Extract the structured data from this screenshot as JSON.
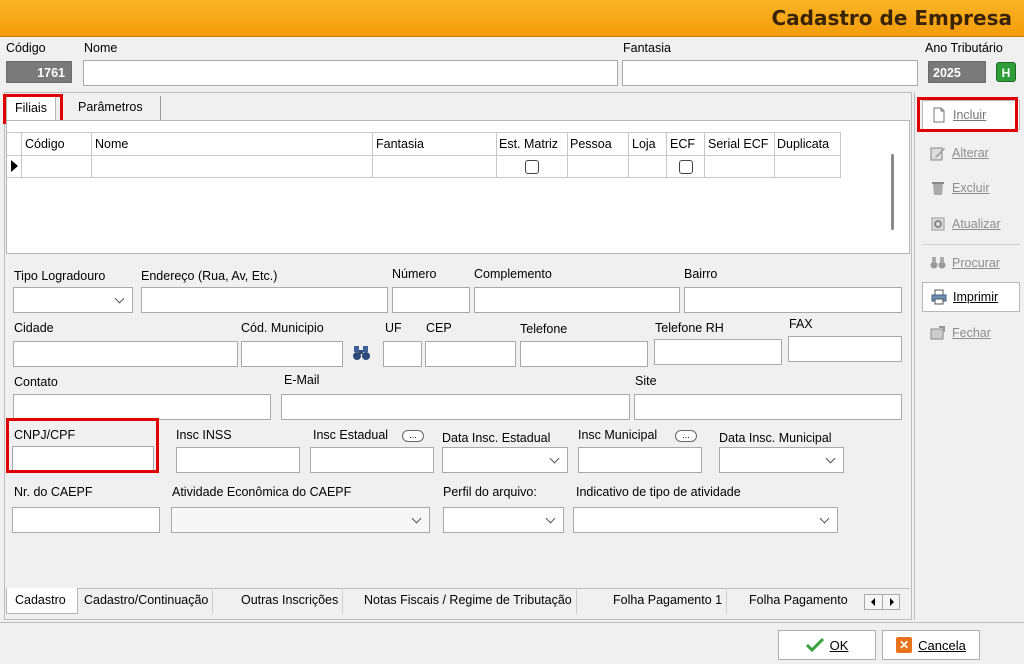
{
  "window": {
    "title": "Cadastro de Empresa"
  },
  "header": {
    "codigo_label": "Código",
    "codigo_value": "1761",
    "nome_label": "Nome",
    "fantasia_label": "Fantasia",
    "ano_label": "Ano Tributário",
    "ano_value": "2025",
    "ano_button": "H"
  },
  "top_tabs": [
    "Filiais",
    "Parâmetros"
  ],
  "grid": {
    "columns": [
      "Código",
      "Nome",
      "Fantasia",
      "Est. Matriz",
      "Pessoa",
      "Loja",
      "ECF",
      "Serial ECF",
      "Duplicata"
    ]
  },
  "form": {
    "tipo_logradouro": "Tipo Logradouro",
    "endereco": "Endereço (Rua, Av,  Etc.)",
    "numero": "Número",
    "complemento": "Complemento",
    "bairro": "Bairro",
    "cidade": "Cidade",
    "cod_municipio": "Cód. Municipio",
    "uf": "UF",
    "cep": "CEP",
    "telefone": "Telefone",
    "telefone_rh": "Telefone RH",
    "fax": "FAX",
    "contato": "Contato",
    "email": "E-Mail",
    "site": "Site",
    "cnpj": "CNPJ/CPF",
    "insc_inss": "Insc INSS",
    "insc_estadual": "Insc Estadual",
    "data_insc_estadual": "Data Insc. Estadual",
    "insc_municipal": "Insc Municipal",
    "data_insc_municipal": "Data Insc. Municipal",
    "nr_caepf": "Nr. do CAEPF",
    "atividade_caepf": "Atividade Econômica do CAEPF",
    "perfil_arquivo": "Perfil do arquivo:",
    "indicativo_atividade": "Indicativo de tipo de atividade",
    "dots": "..."
  },
  "bottom_tabs": [
    "Cadastro",
    "Cadastro/Continuação",
    "Outras Inscrições",
    "Notas Fiscais / Regime de Tributação",
    "Folha Pagamento 1",
    "Folha Pagamento"
  ],
  "side_buttons": {
    "incluir": "Incluir",
    "alterar": "Alterar",
    "excluir": "Excluir",
    "atualizar": "Atualizar",
    "procurar": "Procurar",
    "imprimir": "Imprimir",
    "fechar": "Fechar"
  },
  "footer": {
    "ok": "OK",
    "cancela": "Cancela"
  },
  "colors": {
    "title_bar": "#f5a31a",
    "highlight": "#e00000",
    "ok_check": "#3aa23a",
    "cancel_icon": "#e8731a"
  }
}
